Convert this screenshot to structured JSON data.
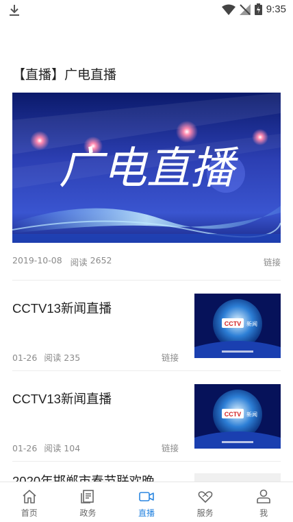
{
  "status_bar": {
    "time": "9:35"
  },
  "section": {
    "title": "【直播】广电直播"
  },
  "hero": {
    "image_text": "广电直播",
    "date": "2019-10-08",
    "read_label": "阅读",
    "read_count": "2652",
    "link_label": "链接"
  },
  "news": [
    {
      "title": "CCTV13新闻直播",
      "date": "01-26",
      "read": "阅读 235",
      "link": "链接",
      "logo_text": "新闻"
    },
    {
      "title": "CCTV13新闻直播",
      "date": "01-26",
      "read": "阅读 104",
      "link": "链接",
      "logo_text": "新闻"
    }
  ],
  "partial_item": {
    "title": "2020年邯郸市春节联欢晚"
  },
  "tabs": [
    {
      "label": "首页",
      "icon": "home-icon"
    },
    {
      "label": "政务",
      "icon": "document-icon"
    },
    {
      "label": "直播",
      "icon": "video-camera-icon"
    },
    {
      "label": "服务",
      "icon": "heart-hands-icon"
    },
    {
      "label": "我",
      "icon": "person-icon"
    }
  ],
  "colors": {
    "accent": "#2a86e0",
    "text": "#222222",
    "muted": "#8a8a8a"
  }
}
